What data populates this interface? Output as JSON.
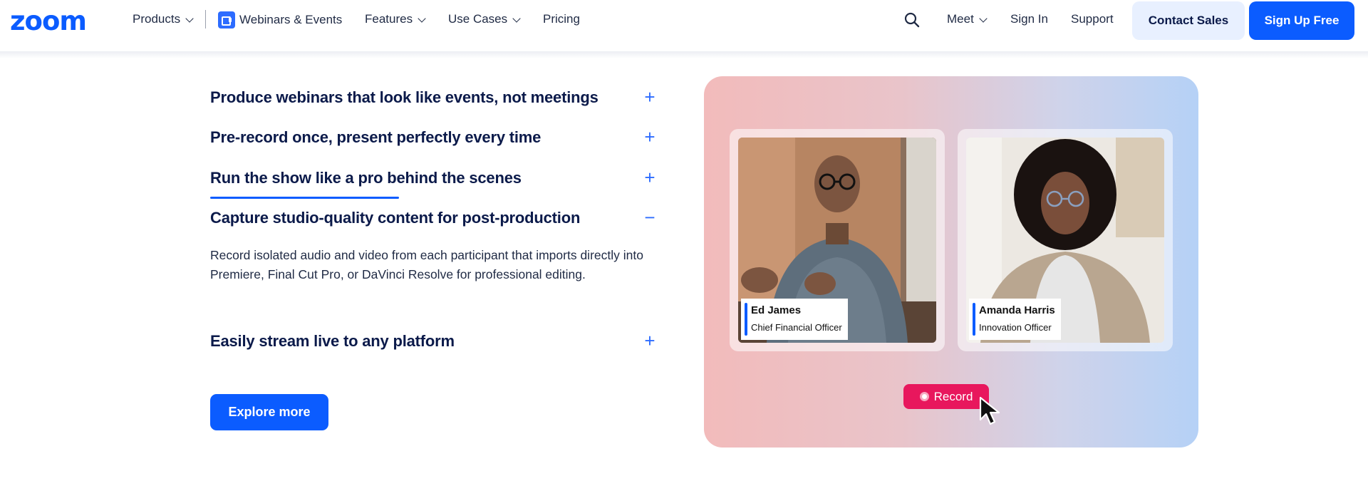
{
  "header": {
    "logo_text": "zoom",
    "nav": [
      {
        "label": "Products",
        "has_dropdown": true
      },
      {
        "label": "Webinars & Events",
        "icon": "webinar-icon"
      },
      {
        "label": "Features",
        "has_dropdown": true
      },
      {
        "label": "Use Cases",
        "has_dropdown": true
      },
      {
        "label": "Pricing"
      }
    ],
    "right_nav": [
      {
        "label": "Meet",
        "has_dropdown": true
      },
      {
        "label": "Sign In"
      },
      {
        "label": "Support"
      }
    ],
    "search_icon": "search-icon",
    "contact_sales": "Contact Sales",
    "sign_up": "Sign Up Free"
  },
  "accordion": {
    "items": [
      {
        "title": "Produce webinars that look like events, not meetings",
        "state": "collapsed",
        "toggle": "+"
      },
      {
        "title": "Pre-record once, present perfectly every time",
        "state": "collapsed",
        "toggle": "+"
      },
      {
        "title": "Run the show like a pro behind the scenes",
        "state": "collapsed",
        "toggle": "+"
      },
      {
        "title": "Capture studio-quality content for post-production",
        "state": "expanded",
        "toggle": "−",
        "body": "Record isolated audio and video from each participant that imports directly into Premiere, Final Cut Pro, or DaVinci Resolve for professional editing."
      },
      {
        "title": "Easily stream live to any platform",
        "state": "collapsed",
        "toggle": "+"
      }
    ],
    "cta": "Explore more"
  },
  "showcase": {
    "participants": [
      {
        "name": "Ed James",
        "role": "Chief Financial Officer"
      },
      {
        "name": "Amanda Harris",
        "role": "Innovation Officer"
      }
    ],
    "record_label": "Record",
    "colors": {
      "accent": "#0b5cff",
      "record": "#e8175d"
    }
  }
}
